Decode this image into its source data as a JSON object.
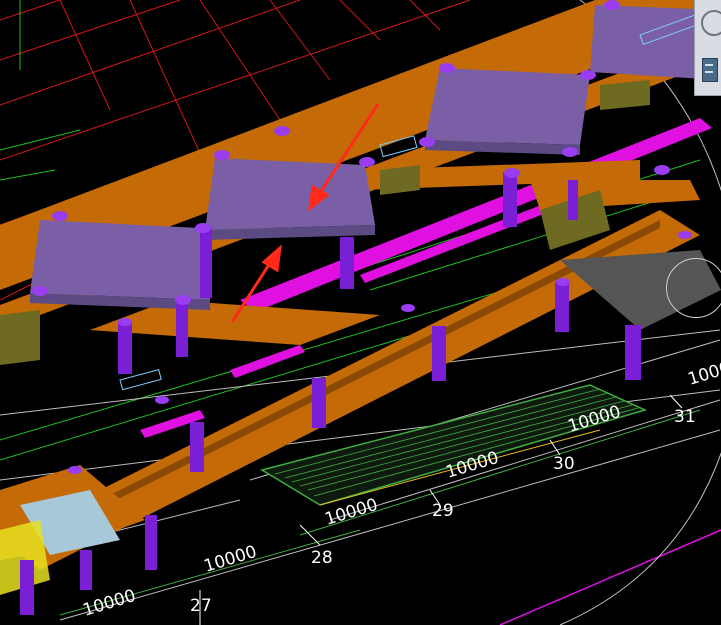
{
  "app": {
    "title": ""
  },
  "colors": {
    "background": "#000000",
    "slab": "#c46a06",
    "roof_top": "#7a5fa6",
    "roof_side": "#5c4a82",
    "column": "#7a1fd6",
    "column_cap": "#9a3cf0",
    "beam_magenta": "#e010e0",
    "grid_red": "#d21818",
    "grid_green": "#20c020",
    "arrow_red": "#ff2a1a",
    "dim_line": "#3fae3f",
    "axis_line": "#ffffff"
  },
  "dimensions": {
    "label_a": "10000",
    "label_b": "10000",
    "label_c": "10000",
    "label_d": "10000",
    "label_e": "10000",
    "label_f": "10000",
    "label_g": "10000"
  },
  "axes": {
    "a27": "27",
    "a28": "28",
    "a29": "29",
    "a30": "30",
    "a31": "31"
  },
  "view_cube": {
    "icon": "view-cube-icon",
    "nav_icon": "navigation-bar-icon"
  }
}
